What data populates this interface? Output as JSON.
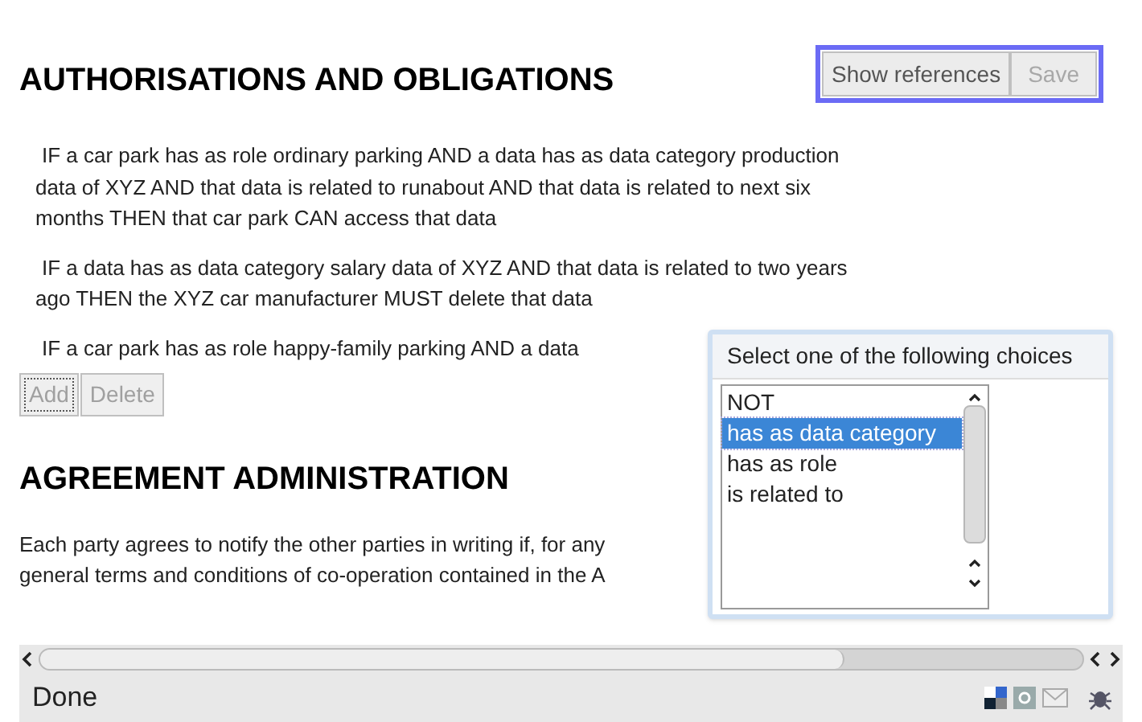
{
  "sections": [
    {
      "kind": "rules",
      "heading": "AUTHORISATIONS AND OBLIGATIONS",
      "toolbar": [
        {
          "label": "Show references",
          "disabled": false
        },
        {
          "label": "Save",
          "disabled": true
        }
      ],
      "rules": [
        "IF a car park has as role ordinary parking AND a data has as data category production data of XYZ AND that data is related to runabout AND that data is related to next six months THEN that car park CAN access that data",
        "IF a data has as data category salary data of XYZ AND that data is related to two years ago THEN the XYZ car manufacturer MUST delete that data",
        "IF a car park has as role happy-family parking AND a data"
      ],
      "buttons": [
        {
          "label": "Add",
          "disabled": true
        },
        {
          "label": "Delete",
          "disabled": true
        }
      ]
    },
    {
      "kind": "text",
      "heading": "AGREEMENT ADMINISTRATION",
      "paragraph_lines": [
        "Each party agrees to notify the other parties in writing if, for any",
        "general terms and conditions of co-operation contained in the A"
      ]
    }
  ],
  "popup": {
    "title": "Select one of the following choices",
    "choices": [
      {
        "label": "NOT",
        "selected": false
      },
      {
        "label": "has as data category",
        "selected": true
      },
      {
        "label": "has as role",
        "selected": false
      },
      {
        "label": "is related to",
        "selected": false
      }
    ]
  },
  "status_bar": {
    "text": "Done"
  }
}
